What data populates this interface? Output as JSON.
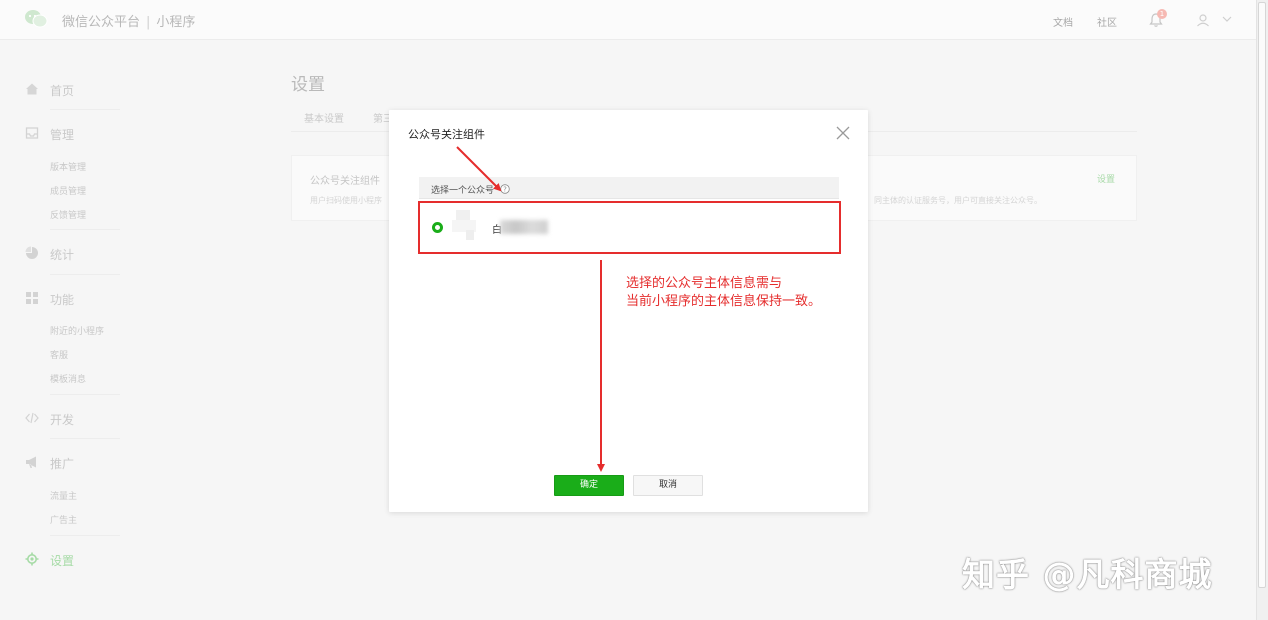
{
  "header": {
    "brand": "微信公众平台",
    "product": "小程序",
    "links": [
      "文档",
      "社区"
    ],
    "notification_count": "1"
  },
  "sidebar": {
    "sections": [
      {
        "label": "首页",
        "icon": "home-icon",
        "items": []
      },
      {
        "label": "管理",
        "icon": "inbox-icon",
        "items": [
          "版本管理",
          "成员管理",
          "反馈管理"
        ]
      },
      {
        "label": "统计",
        "icon": "pie-chart-icon",
        "items": []
      },
      {
        "label": "功能",
        "icon": "grid-icon",
        "items": [
          "附近的小程序",
          "客服",
          "模板消息"
        ]
      },
      {
        "label": "开发",
        "icon": "code-icon",
        "items": []
      },
      {
        "label": "推广",
        "icon": "megaphone-icon",
        "items": [
          "流量主",
          "广告主"
        ]
      },
      {
        "label": "设置",
        "icon": "gear-icon",
        "items": [],
        "active": true
      }
    ]
  },
  "main": {
    "title": "设置",
    "tabs": [
      "基本设置",
      "第三"
    ],
    "card": {
      "title": "公众号关注组件",
      "desc_left": "用户扫码使用小程序",
      "desc_right": "同主体的认证服务号，用户可直接关注公众号。",
      "link": "设置"
    }
  },
  "modal": {
    "title": "公众号关注组件",
    "list_header": "选择一个公众号",
    "account_name_prefix": "白",
    "confirm": "确定",
    "cancel": "取消"
  },
  "annotation": {
    "line1": "选择的公众号主体信息需与",
    "line2": "当前小程序的主体信息保持一致。",
    "color": "#e52d2d"
  },
  "watermark": "知乎 @凡科商城",
  "colors": {
    "accent": "#1aad19",
    "annotation": "#e52d2d"
  }
}
